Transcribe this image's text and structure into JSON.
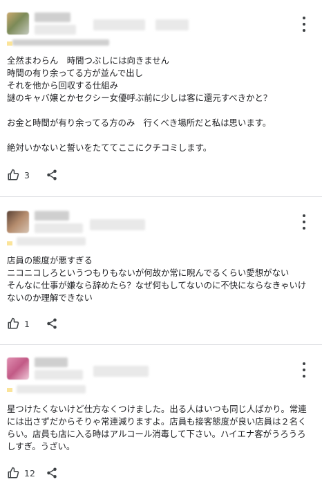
{
  "reviews": [
    {
      "text": "全然まわらん　時間つぶしには向きません\n時間の有り余ってる方が並んで出し\nそれを他から回収する仕組み\n謎のキャバ嬢とかセクシー女優呼ぶ前に少しは客に還元すべきかと？\n\nお金と時間が有り余ってる方のみ　行くべき場所だと私は思います。\n\n絶対いかないと誓いをたててここにクチコミします。",
      "likes": "3",
      "avatar_color": "#7c8a57"
    },
    {
      "text": "店員の態度が悪すぎる\nニコニコしろというつもりもないが何故か常に睨んでるくらい愛想がない\nそんなに仕事が嫌なら辞めたら？なぜ何もしてないのに不快にならなきゃいけ\nないのか理解できない",
      "likes": "1",
      "avatar_color": "#8a6a55"
    },
    {
      "text": "星つけたくないけど仕方なくつけました。出る人はいつも同じ人ばかり。常連\nには出さずだからそりゃ常連減りますよ。店員も接客態度が良い店員は２名く\nらい。店員も店に入る時はアルコール消毒して下さい。ハイエナ客がうろうろ\nしすぎ。うざい。",
      "likes": "12",
      "avatar_color": "#d1789e"
    }
  ]
}
